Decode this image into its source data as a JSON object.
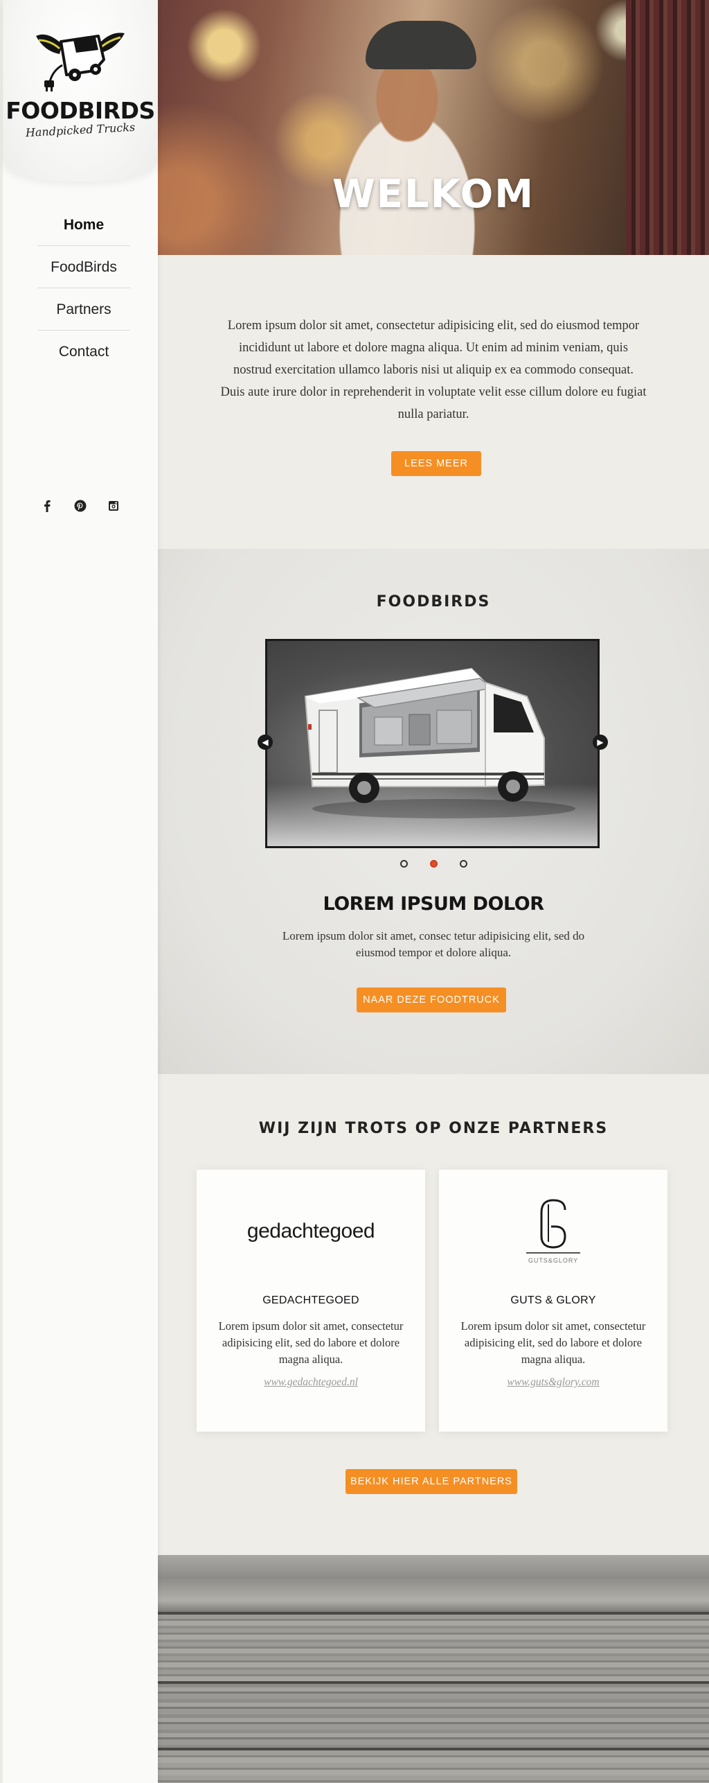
{
  "brand": {
    "name": "FOODBIRDS",
    "tagline": "Handpicked Trucks"
  },
  "nav": {
    "items": [
      {
        "label": "Home",
        "active": true
      },
      {
        "label": "FoodBirds",
        "active": false
      },
      {
        "label": "Partners",
        "active": false
      },
      {
        "label": "Contact",
        "active": false
      }
    ]
  },
  "social": [
    {
      "icon": "facebook-icon"
    },
    {
      "icon": "pinterest-icon"
    },
    {
      "icon": "instagram-icon"
    }
  ],
  "hero": {
    "title": "WELKOM"
  },
  "intro": {
    "text": "Lorem ipsum dolor sit amet, consectetur adipisicing elit, sed do eiusmod tempor incididunt ut labore et dolore magna aliqua. Ut enim ad minim veniam, quis nostrud exercitation ullamco laboris nisi ut aliquip ex ea commodo consequat. Duis aute irure dolor in reprehenderit in voluptate velit esse cillum dolore eu fugiat nulla pariatur.",
    "button": "LEES MEER"
  },
  "foodbirds": {
    "title": "FOODBIRDS",
    "slider": {
      "prev_icon": "chevron-left-icon",
      "next_icon": "chevron-right-icon",
      "dots": [
        false,
        true,
        false
      ]
    },
    "slide_title": "LOREM IPSUM DOLOR",
    "slide_text": "Lorem ipsum dolor sit amet, consec tetur adipisicing elit, sed do eiusmod tempor et dolore aliqua.",
    "button": "NAAR DEZE FOODTRUCK"
  },
  "partners": {
    "title": "WIJ ZIJN TROTS OP ONZE PARTNERS",
    "cards": [
      {
        "logo_text": "gedachtegoed",
        "name": "GEDACHTEGOED",
        "text": "Lorem ipsum dolor sit amet, consectetur adipisicing elit, sed do labore et dolore magna aliqua.",
        "link": "www.gedachtegoed.nl"
      },
      {
        "logo_text": "GUTS&GLORY",
        "name": "GUTS & GLORY",
        "text": "Lorem ipsum dolor sit amet, consectetur adipisicing elit, sed do labore et dolore magna aliqua.",
        "link": "www.guts&glory.com"
      }
    ],
    "button": "BEKIJK HIER ALLE PARTNERS"
  },
  "colors": {
    "accent": "#f58f24",
    "active_dot": "#e0512a",
    "section_bg": "#efede7"
  }
}
